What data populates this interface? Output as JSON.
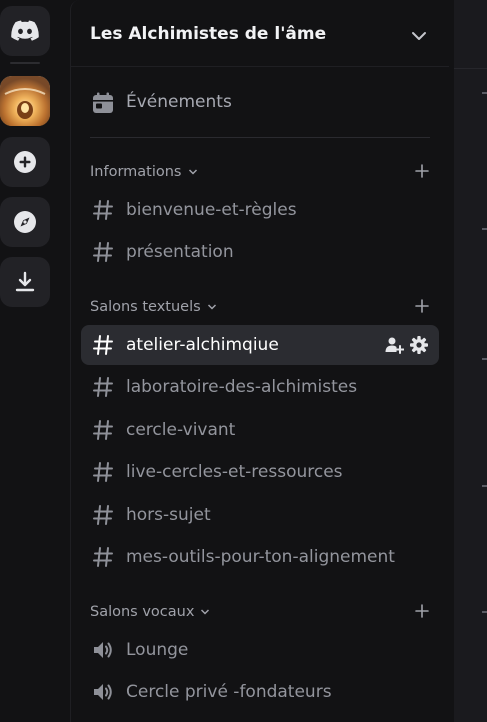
{
  "rail": {
    "home_icon": "discord-logo-icon",
    "server_image": "server-icon",
    "add_icon": "plus-circle-icon",
    "discover_icon": "compass-icon",
    "download_icon": "download-icon"
  },
  "guild": {
    "name": "Les Alchimistes de l'âme",
    "chevron_icon": "chevron-down-icon"
  },
  "events": {
    "label": "Événements",
    "icon": "calendar-icon"
  },
  "categories": [
    {
      "label": "Informations",
      "channels": [
        {
          "type": "text",
          "label": "bienvenue-et-règles"
        },
        {
          "type": "text",
          "label": "présentation"
        }
      ]
    },
    {
      "label": "Salons textuels",
      "channels": [
        {
          "type": "text",
          "label": "atelier-alchimqiue",
          "selected": true
        },
        {
          "type": "text",
          "label": "laboratoire-des-alchimistes"
        },
        {
          "type": "text",
          "label": "cercle-vivant"
        },
        {
          "type": "text",
          "label": "live-cercles-et-ressources"
        },
        {
          "type": "text",
          "label": "hors-sujet"
        },
        {
          "type": "text",
          "label": "mes-outils-pour-ton-alignement"
        }
      ]
    },
    {
      "label": "Salons vocaux",
      "channels": [
        {
          "type": "voice",
          "label": "Lounge"
        },
        {
          "type": "voice",
          "label": "Cercle privé -fondateurs"
        }
      ]
    }
  ],
  "colors": {
    "background": "#121214",
    "selected_row": "#2b2c31",
    "text_muted": "#93959d",
    "text_active": "#ffffff"
  }
}
